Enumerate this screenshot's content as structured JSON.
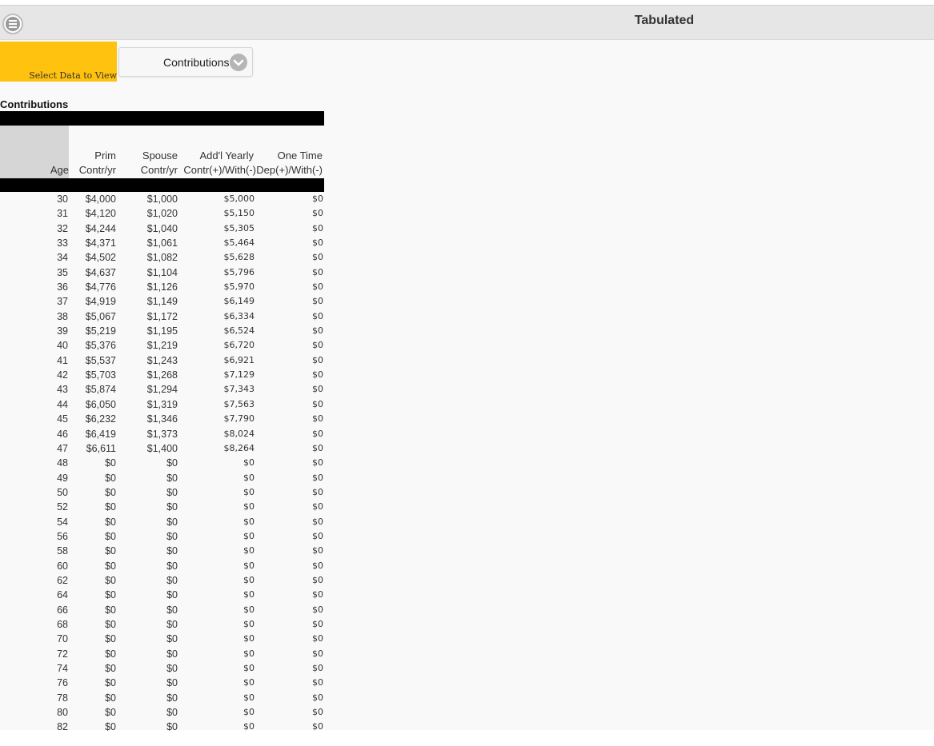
{
  "app": {
    "title": "Tabulated"
  },
  "selector": {
    "label": "Select Data to View",
    "value": "Contributions"
  },
  "section": {
    "title": "Contributions"
  },
  "table": {
    "headers": {
      "age": "Age",
      "prim_1": "Prim",
      "prim_2": "Contr/yr",
      "spouse_1": "Spouse",
      "spouse_2": "Contr/yr",
      "addl_1": "Add'l Yearly",
      "addl_2": "Contr(+)/With(-)",
      "one_1": "One Time",
      "one_2": "Dep(+)/With(-)"
    },
    "rows": [
      [
        "30",
        "$4,000",
        "$1,000",
        "$5,000",
        "$0"
      ],
      [
        "31",
        "$4,120",
        "$1,020",
        "$5,150",
        "$0"
      ],
      [
        "32",
        "$4,244",
        "$1,040",
        "$5,305",
        "$0"
      ],
      [
        "33",
        "$4,371",
        "$1,061",
        "$5,464",
        "$0"
      ],
      [
        "34",
        "$4,502",
        "$1,082",
        "$5,628",
        "$0"
      ],
      [
        "35",
        "$4,637",
        "$1,104",
        "$5,796",
        "$0"
      ],
      [
        "36",
        "$4,776",
        "$1,126",
        "$5,970",
        "$0"
      ],
      [
        "37",
        "$4,919",
        "$1,149",
        "$6,149",
        "$0"
      ],
      [
        "38",
        "$5,067",
        "$1,172",
        "$6,334",
        "$0"
      ],
      [
        "39",
        "$5,219",
        "$1,195",
        "$6,524",
        "$0"
      ],
      [
        "40",
        "$5,376",
        "$1,219",
        "$6,720",
        "$0"
      ],
      [
        "41",
        "$5,537",
        "$1,243",
        "$6,921",
        "$0"
      ],
      [
        "42",
        "$5,703",
        "$1,268",
        "$7,129",
        "$0"
      ],
      [
        "43",
        "$5,874",
        "$1,294",
        "$7,343",
        "$0"
      ],
      [
        "44",
        "$6,050",
        "$1,319",
        "$7,563",
        "$0"
      ],
      [
        "45",
        "$6,232",
        "$1,346",
        "$7,790",
        "$0"
      ],
      [
        "46",
        "$6,419",
        "$1,373",
        "$8,024",
        "$0"
      ],
      [
        "47",
        "$6,611",
        "$1,400",
        "$8,264",
        "$0"
      ],
      [
        "48",
        "$0",
        "$0",
        "$0",
        "$0"
      ],
      [
        "49",
        "$0",
        "$0",
        "$0",
        "$0"
      ],
      [
        "50",
        "$0",
        "$0",
        "$0",
        "$0"
      ],
      [
        "52",
        "$0",
        "$0",
        "$0",
        "$0"
      ],
      [
        "54",
        "$0",
        "$0",
        "$0",
        "$0"
      ],
      [
        "56",
        "$0",
        "$0",
        "$0",
        "$0"
      ],
      [
        "58",
        "$0",
        "$0",
        "$0",
        "$0"
      ],
      [
        "60",
        "$0",
        "$0",
        "$0",
        "$0"
      ],
      [
        "62",
        "$0",
        "$0",
        "$0",
        "$0"
      ],
      [
        "64",
        "$0",
        "$0",
        "$0",
        "$0"
      ],
      [
        "66",
        "$0",
        "$0",
        "$0",
        "$0"
      ],
      [
        "68",
        "$0",
        "$0",
        "$0",
        "$0"
      ],
      [
        "70",
        "$0",
        "$0",
        "$0",
        "$0"
      ],
      [
        "72",
        "$0",
        "$0",
        "$0",
        "$0"
      ],
      [
        "74",
        "$0",
        "$0",
        "$0",
        "$0"
      ],
      [
        "76",
        "$0",
        "$0",
        "$0",
        "$0"
      ],
      [
        "78",
        "$0",
        "$0",
        "$0",
        "$0"
      ],
      [
        "80",
        "$0",
        "$0",
        "$0",
        "$0"
      ],
      [
        "82",
        "$0",
        "$0",
        "$0",
        "$0"
      ]
    ]
  },
  "icons": {
    "menu": "menu-icon",
    "dropdown": "chevron-down-icon"
  },
  "colors": {
    "accent": "#ffc20e",
    "topbar": "#e6e6e6",
    "header_bar": "#000000"
  }
}
